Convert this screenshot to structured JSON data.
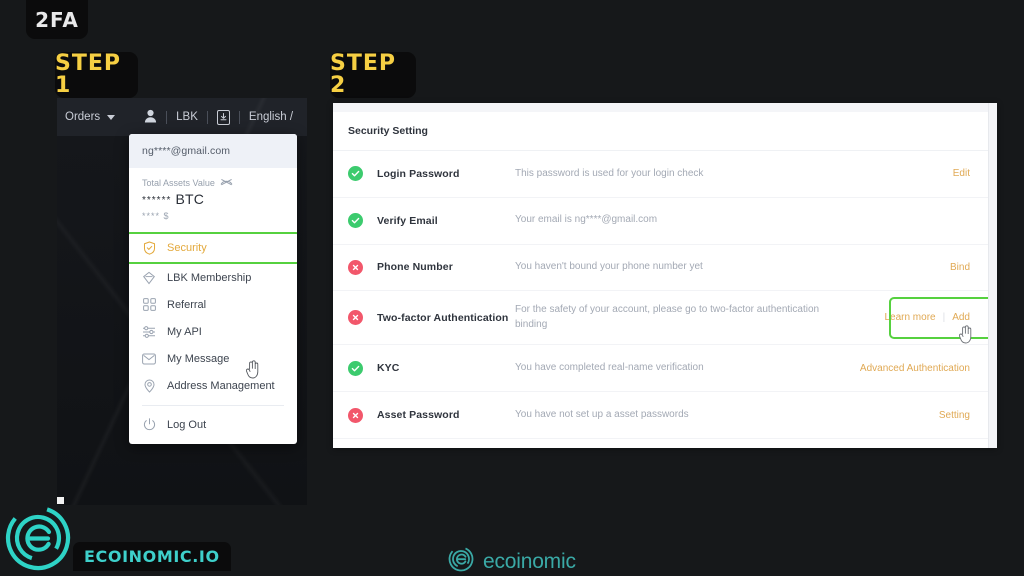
{
  "badges": {
    "topic": "2FA",
    "step1": "STEP 1",
    "step2": "STEP 2"
  },
  "left_panel": {
    "topbar": {
      "orders_label": "Orders",
      "caret_icon": "chevron-down-icon",
      "user_icon": "user-icon",
      "brand_label": "LBK",
      "download_icon": "download-app-icon",
      "language_label": "English /"
    },
    "dropdown": {
      "email": "ng****@gmail.com",
      "assets_label": "Total Assets Value",
      "eye_icon": "eye-hidden-icon",
      "assets_btc_value": "******",
      "assets_btc_unit": "BTC",
      "assets_usd_value": "****",
      "assets_usd_unit": "$",
      "items": [
        {
          "label": "Security",
          "icon": "shield-check-icon",
          "active": true
        },
        {
          "label": "LBK Membership",
          "icon": "diamond-icon",
          "active": false
        },
        {
          "label": "Referral",
          "icon": "grid-squares-icon",
          "active": false
        },
        {
          "label": "My API",
          "icon": "sliders-icon",
          "active": false
        },
        {
          "label": "My Message",
          "icon": "envelope-icon",
          "active": false
        },
        {
          "label": "Address Management",
          "icon": "location-pin-icon",
          "active": false
        }
      ],
      "logout": {
        "label": "Log Out",
        "icon": "power-icon"
      }
    }
  },
  "right_panel": {
    "title": "Security Setting",
    "rows": [
      {
        "status": "ok",
        "title": "Login Password",
        "description": "This password is used for your login check",
        "actions": [
          "Edit"
        ]
      },
      {
        "status": "ok",
        "title": "Verify Email",
        "description": "Your email is ng****@gmail.com",
        "actions": []
      },
      {
        "status": "bad",
        "title": "Phone Number",
        "description": "You haven't bound your phone number yet",
        "actions": [
          "Bind"
        ]
      },
      {
        "status": "bad",
        "title": "Two-factor Authentication",
        "description": "For the safety of your account, please go to two-factor authentication binding",
        "actions": [
          "Learn more",
          "Add"
        ],
        "highlighted": true
      },
      {
        "status": "ok",
        "title": "KYC",
        "description": "You have completed real-name verification",
        "actions": [
          "Advanced Authentication"
        ]
      },
      {
        "status": "bad",
        "title": "Asset Password",
        "description": "You have not set up a asset passwords",
        "actions": [
          "Setting"
        ]
      }
    ]
  },
  "branding": {
    "logo_icon": "ecoinomic-logo-icon",
    "pill_text": "ECOINOMIC.IO",
    "center_icon": "ecoinomic-logo-icon",
    "center_text": "ecoinomic"
  },
  "colors": {
    "accent_green": "#56d13f",
    "accent_amber": "#e0a954",
    "status_ok": "#3ccb6e",
    "status_bad": "#f2576b",
    "badge_yellow": "#f6cf43",
    "brand_teal": "#3ed0cb",
    "page_bg": "#16181a"
  }
}
